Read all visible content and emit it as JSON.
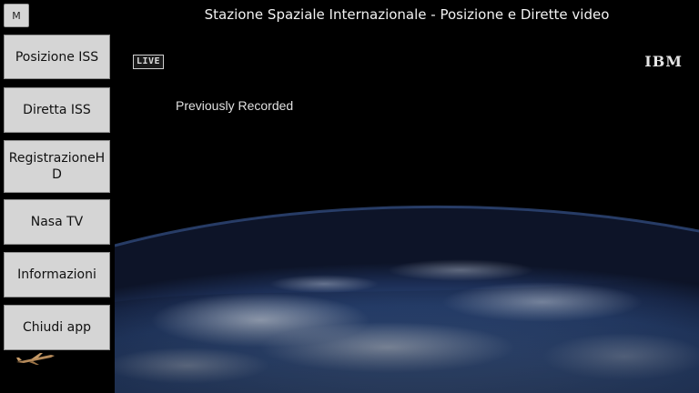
{
  "window": {
    "title": "Stazione Spaziale Internazionale - Posizione e Dirette video",
    "menu_button_label": "M"
  },
  "sidebar": {
    "items": [
      {
        "label": "Posizione ISS"
      },
      {
        "label": "Diretta ISS"
      },
      {
        "label": "RegistrazioneHD"
      },
      {
        "label": "Nasa TV"
      },
      {
        "label": "Informazioni"
      },
      {
        "label": "Chiudi app"
      }
    ]
  },
  "video": {
    "live_badge": "LIVE",
    "logo_text": "IBM",
    "overlay_text": "Previously Recorded"
  },
  "colors": {
    "background": "#000000",
    "button_face": "#d5d5d5",
    "button_border": "#8e8e8e",
    "title_text": "#f2f2f2",
    "earth_blue": "#3b5c95"
  },
  "icons": {
    "sidebar_bottom": "airplane-icon"
  }
}
